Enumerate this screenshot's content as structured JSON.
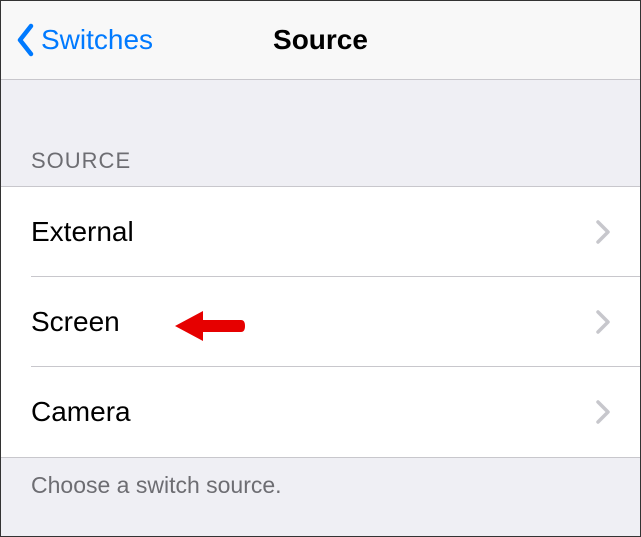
{
  "navbar": {
    "back_label": "Switches",
    "title": "Source"
  },
  "section": {
    "header": "SOURCE",
    "footer": "Choose a switch source."
  },
  "items": [
    {
      "label": "External"
    },
    {
      "label": "Screen"
    },
    {
      "label": "Camera"
    }
  ],
  "annotation": {
    "target_index": 1,
    "icon_name": "red-arrow-annotation"
  }
}
